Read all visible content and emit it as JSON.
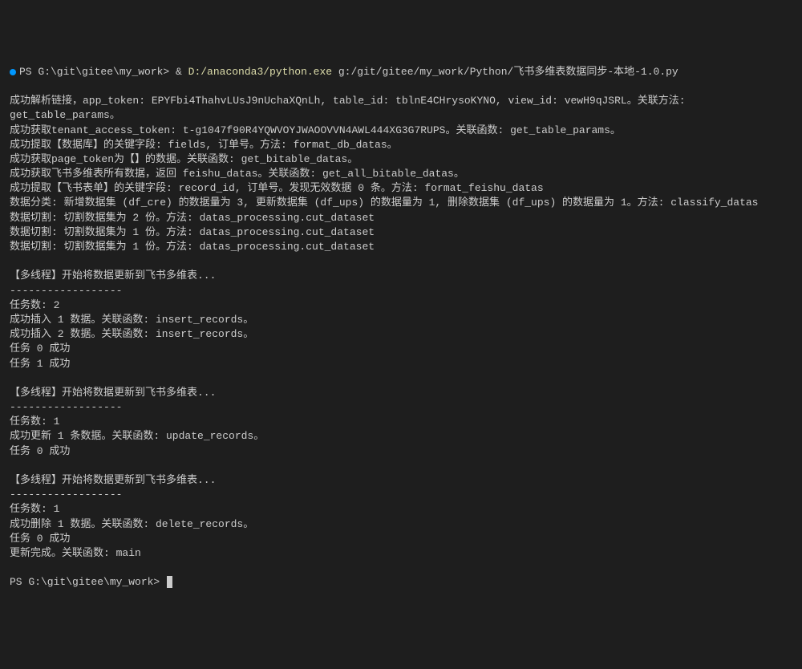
{
  "prompt1": {
    "ps": "PS ",
    "path": "G:\\git\\gitee\\my_work>",
    "amp": " & ",
    "python_path": "D:/anaconda3/python.exe",
    "script_path": " g:/git/gitee/my_work/Python/飞书多维表数据同步-本地-1.0.py"
  },
  "lines": [
    "成功解析链接，app_token: EPYFbi4ThahvLUsJ9nUchaXQnLh, table_id: tblnE4CHrysoKYNO, view_id: vewH9qJSRL。关联方法: get_table_params。",
    "成功获取tenant_access_token: t-g1047f90R4YQWVOYJWAOOVVN4AWL444XG3G7RUPS。关联函数: get_table_params。",
    "成功提取【数据库】的关键字段: fields, 订单号。方法: format_db_datas。",
    "成功获取page_token为【】的数据。关联函数: get_bitable_datas。",
    "成功获取飞书多维表所有数据，返回 feishu_datas。关联函数: get_all_bitable_datas。",
    "成功提取【飞书表单】的关键字段: record_id, 订单号。发现无效数据 0 条。方法: format_feishu_datas",
    "数据分类: 新增数据集 (df_cre) 的数据量为 3, 更新数据集 (df_ups) 的数据量为 1, 删除数据集 (df_ups) 的数据量为 1。方法: classify_datas",
    "数据切割: 切割数据集为 2 份。方法: datas_processing.cut_dataset",
    "数据切割: 切割数据集为 1 份。方法: datas_processing.cut_dataset",
    "数据切割: 切割数据集为 1 份。方法: datas_processing.cut_dataset",
    "",
    "【多线程】开始将数据更新到飞书多维表...",
    "------------------",
    "任务数: 2",
    "成功插入 1 数据。关联函数: insert_records。",
    "成功插入 2 数据。关联函数: insert_records。",
    "任务 0 成功",
    "任务 1 成功",
    "",
    "【多线程】开始将数据更新到飞书多维表...",
    "------------------",
    "任务数: 1",
    "成功更新 1 条数据。关联函数: update_records。",
    "任务 0 成功",
    "",
    "【多线程】开始将数据更新到飞书多维表...",
    "------------------",
    "任务数: 1",
    "成功删除 1 数据。关联函数: delete_records。",
    "任务 0 成功",
    "更新完成。关联函数: main"
  ],
  "prompt2": {
    "ps": "PS ",
    "path": "G:\\git\\gitee\\my_work>"
  }
}
